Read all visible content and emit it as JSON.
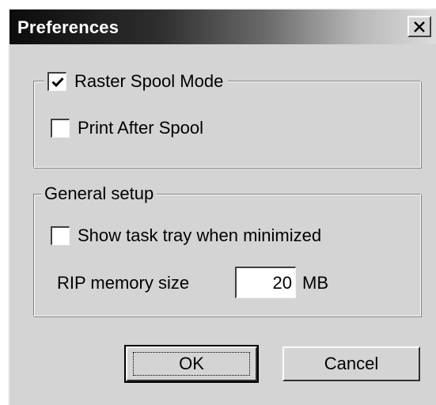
{
  "window": {
    "title": "Preferences",
    "close_glyph": "✕"
  },
  "raster_group": {
    "raster_spool_label": "Raster Spool Mode",
    "raster_spool_checked": true,
    "print_after_spool_label": "Print After Spool",
    "print_after_spool_checked": false
  },
  "general_group": {
    "legend": "General setup",
    "show_tray_label": "Show task tray when minimized",
    "show_tray_checked": false,
    "rip_memory_label": "RIP memory size",
    "rip_memory_value": "20",
    "rip_memory_unit": "MB"
  },
  "buttons": {
    "ok_label": "OK",
    "cancel_label": "Cancel"
  },
  "icons": {
    "close": "close-icon",
    "check": "checkmark-icon"
  },
  "colors": {
    "face": "#d4d4d4",
    "title_start": "#0c0c0c",
    "title_end": "#dcdcdc"
  }
}
